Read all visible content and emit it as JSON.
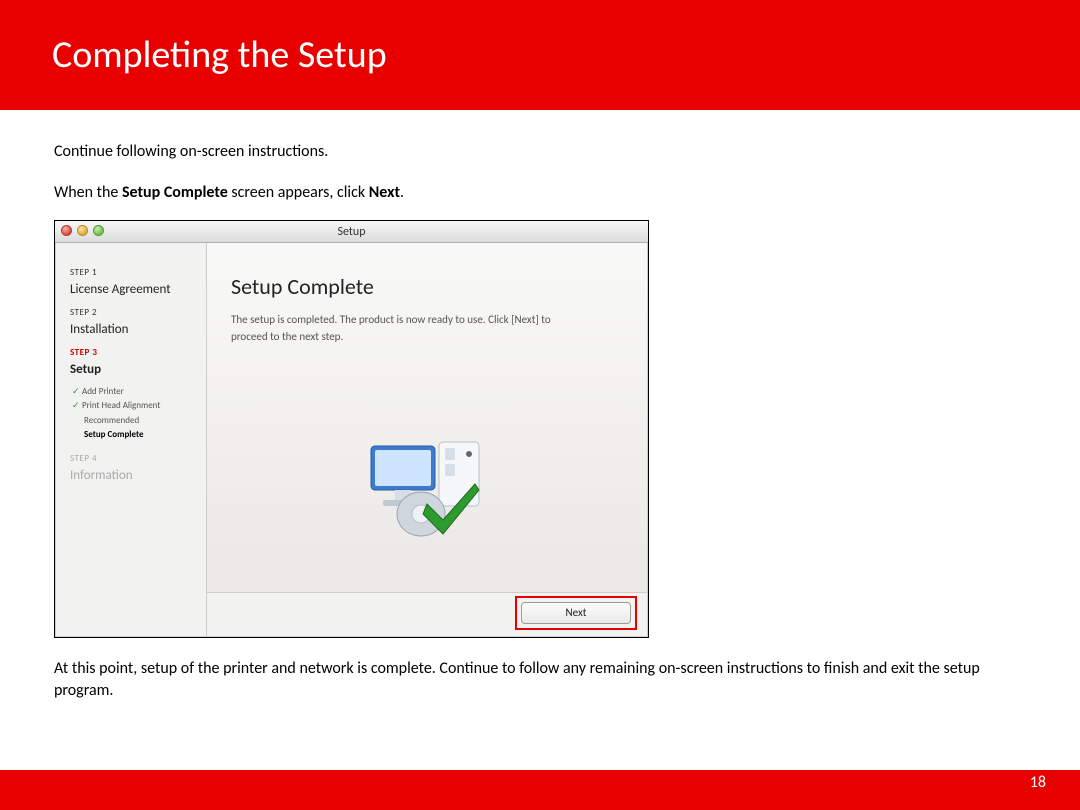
{
  "header": {
    "title": "Completing  the Setup"
  },
  "instructions": {
    "line1": "Continue following on-screen instructions.",
    "line2_pre": "When the  ",
    "line2_b1": "Setup Complete",
    "line2_mid": " screen appears, click ",
    "line2_b2": "Next",
    "line2_post": "."
  },
  "window": {
    "title": "Setup",
    "sidebar": {
      "step1_label": "STEP 1",
      "step1_title": "License Agreement",
      "step2_label": "STEP 2",
      "step2_title": "Installation",
      "step3_label": "STEP 3",
      "step3_title": "Setup",
      "sub1": "Add Printer",
      "sub2": "Print Head Alignment Recommended",
      "sub3": "Setup Complete",
      "step4_label": "STEP 4",
      "step4_title": "Information"
    },
    "content": {
      "heading": "Setup Complete",
      "body": "The setup is completed. The product is now ready to use. Click [Next] to proceed to the next step."
    },
    "next_button": "Next"
  },
  "closing": "At this point, setup of the printer and network is complete.  Continue to follow any remaining on-screen instructions to finish and exit the setup program.",
  "page_number": "18"
}
